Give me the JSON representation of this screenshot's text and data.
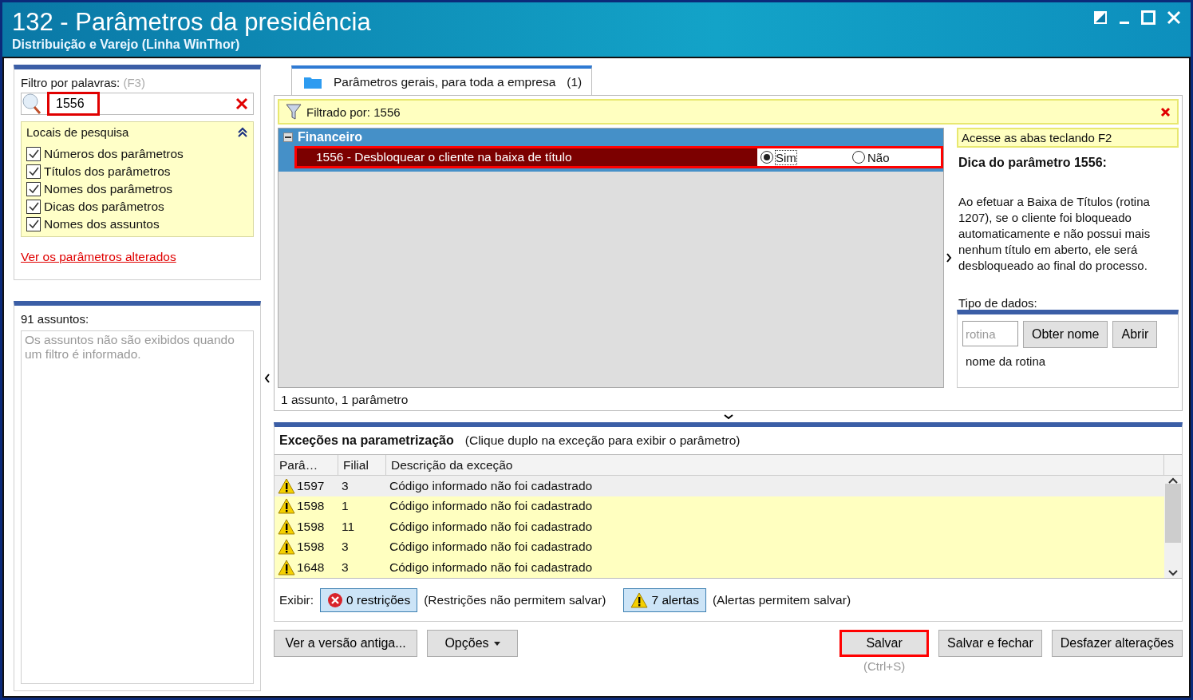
{
  "window": {
    "title": "132 - Parâmetros da presidência",
    "subtitle": "Distribuição e Varejo (Linha WinThor)"
  },
  "filter": {
    "label": "Filtro por palavras:",
    "shortcut": "(F3)",
    "value": "1556",
    "highlighted": true
  },
  "search_locations": {
    "title": "Locais de pesquisa",
    "expanded": true,
    "options": [
      {
        "label": "Números dos parâmetros",
        "checked": true
      },
      {
        "label": "Títulos dos parâmetros",
        "checked": true
      },
      {
        "label": "Nomes dos parâmetros",
        "checked": true
      },
      {
        "label": "Dicas dos parâmetros",
        "checked": true
      },
      {
        "label": "Nomes dos assuntos",
        "checked": true
      }
    ]
  },
  "changed_link": "Ver os parâmetros alterados",
  "subjects": {
    "count_label": "91 assuntos:",
    "message": "Os assuntos não são exibidos quando um filtro é informado."
  },
  "tabs": [
    {
      "label": "Parâmetros gerais, para toda a empresa",
      "count": "(1)",
      "selected": true
    }
  ],
  "filter_bar": {
    "text": "Filtrado por: 1556"
  },
  "tree": [
    {
      "label": "Financeiro",
      "expanded": true,
      "children": [
        {
          "label": "1556 - Desbloquear o cliente na baixa de título",
          "selected": true,
          "highlighted": true,
          "options": [
            {
              "label": "Sim",
              "selected": true
            },
            {
              "label": "Não",
              "selected": false
            }
          ]
        }
      ]
    }
  ],
  "summary": "1 assunto, 1 parâmetro",
  "tip": {
    "hint": "Acesse as abas teclando F2",
    "title": "Dica do parâmetro 1556:",
    "body": "Ao efetuar a Baixa de Títulos (rotina 1207), se o cliente foi bloqueado automaticamente e não possui mais nenhum título em aberto, ele será desbloqueado ao final do processo.",
    "data_type_label": "Tipo de dados:",
    "routine_placeholder": "rotina",
    "buttons": [
      "Obter nome",
      "Abrir"
    ],
    "routine_name": "nome da rotina"
  },
  "exceptions": {
    "title": "Exceções na parametrização",
    "hint": "(Clique duplo na exceção para exibir o parâmetro)",
    "columns": [
      "Parâ…",
      "Filial",
      "Descrição da exceção"
    ],
    "rows": [
      {
        "kind": "alert",
        "parameter": "1597",
        "branch": "3",
        "description": "Código informado não foi cadastrado",
        "selected": true
      },
      {
        "kind": "alert",
        "parameter": "1598",
        "branch": "1",
        "description": "Código informado não foi cadastrado",
        "selected": false
      },
      {
        "kind": "alert",
        "parameter": "1598",
        "branch": "11",
        "description": "Código informado não foi cadastrado",
        "selected": false
      },
      {
        "kind": "alert",
        "parameter": "1598",
        "branch": "3",
        "description": "Código informado não foi cadastrado",
        "selected": false
      },
      {
        "kind": "alert",
        "parameter": "1648",
        "branch": "3",
        "description": "Código informado não foi cadastrado",
        "selected": false
      }
    ],
    "filters_label": "Exibir:",
    "filters": [
      {
        "kind": "restriction",
        "label": "0 restrições",
        "note": "(Restrições não permitem salvar)",
        "selected": true
      },
      {
        "kind": "alert",
        "label": "7 alertas",
        "note": "(Alertas permitem salvar)",
        "selected": true
      }
    ]
  },
  "buttons": [
    {
      "kind": "plain",
      "label": "Ver a versão antiga..."
    },
    {
      "kind": "dropdown",
      "label": "Opções"
    },
    {
      "kind": "action",
      "label": "Salvar",
      "shortcut": "(Ctrl+S)",
      "highlighted": true
    },
    {
      "kind": "action",
      "label": "Salvar e fechar",
      "highlighted": false
    },
    {
      "kind": "action",
      "label": "Desfazer alterações",
      "highlighted": false
    }
  ]
}
